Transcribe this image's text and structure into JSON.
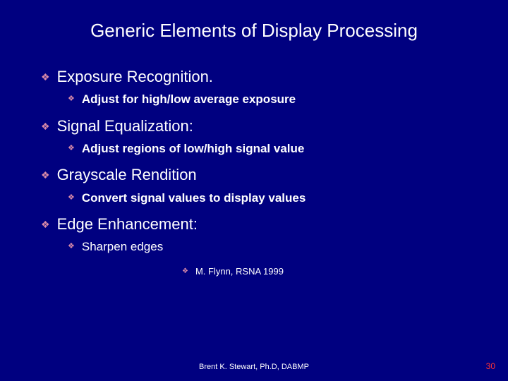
{
  "title": "Generic Elements of Display Processing",
  "items": [
    {
      "label": "Exposure Recognition.",
      "sub": "Adjust for high/low average exposure",
      "bold": true
    },
    {
      "label": "Signal Equalization:",
      "sub": "Adjust regions of low/high signal value",
      "bold": true
    },
    {
      "label": "Grayscale Rendition",
      "sub": "Convert signal values to display values",
      "bold": true
    },
    {
      "label": "Edge Enhancement:",
      "sub": "Sharpen edges",
      "bold": false
    }
  ],
  "citation": "M. Flynn, RSNA 1999",
  "footer": {
    "author": "Brent K. Stewart, Ph.D, DABMP",
    "page": "30"
  },
  "bullets": {
    "l1": "❖",
    "l2": "❖",
    "cite": "❖"
  }
}
